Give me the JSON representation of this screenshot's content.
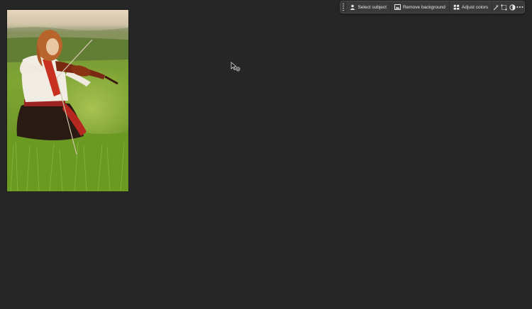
{
  "taskbar": {
    "select_subject_label": "Select subject",
    "remove_background_label": "Remove background",
    "adjust_colors_label": "Adjust colors",
    "icons": [
      "select-subject-icon",
      "remove-background-icon",
      "adjust-colors-icon",
      "magic-wand-icon",
      "transform-icon",
      "mask-icon",
      "more-options-icon"
    ]
  },
  "document": {
    "image_subject": "violinist-in-grass-field"
  },
  "colors": {
    "canvas_background": "#262626",
    "taskbar_background": "#3a3a3a",
    "taskbar_text": "#e6e6e6"
  }
}
